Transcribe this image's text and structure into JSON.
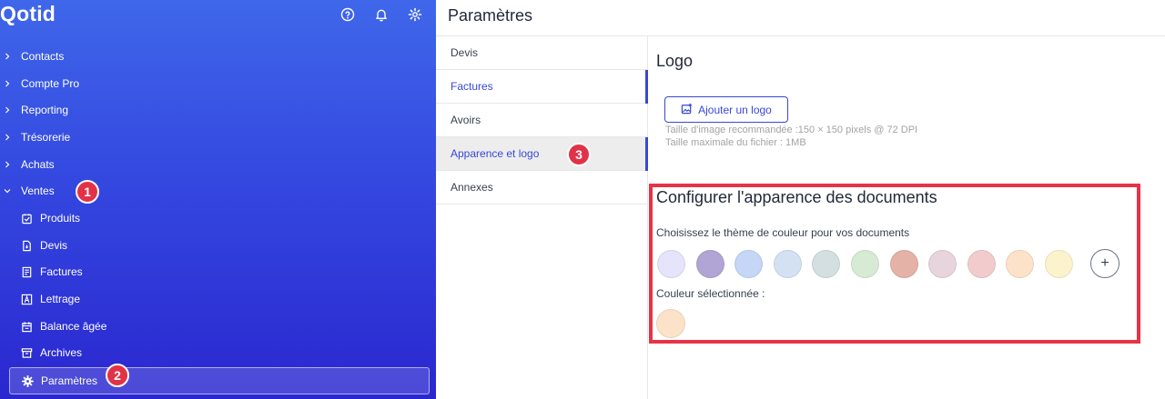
{
  "sidebar": {
    "brand": "Qotid",
    "top_icons": [
      "help-icon",
      "bell-icon",
      "gear-icon"
    ],
    "nav": [
      {
        "label": "Contacts",
        "expanded": false
      },
      {
        "label": "Compte Pro",
        "expanded": false
      },
      {
        "label": "Reporting",
        "expanded": false
      },
      {
        "label": "Trésorerie",
        "expanded": false
      },
      {
        "label": "Achats",
        "expanded": false
      },
      {
        "label": "Ventes",
        "expanded": true
      }
    ],
    "sub_items": [
      {
        "label": "Produits",
        "icon": "product-icon"
      },
      {
        "label": "Devis",
        "icon": "document-icon"
      },
      {
        "label": "Factures",
        "icon": "invoice-icon"
      },
      {
        "label": "Lettrage",
        "icon": "lettering-icon"
      },
      {
        "label": "Balance âgée",
        "icon": "calendar-icon"
      },
      {
        "label": "Archives",
        "icon": "archive-icon"
      },
      {
        "label": "Paramètres",
        "icon": "gear-icon",
        "active": true
      }
    ]
  },
  "annotations": [
    "1",
    "2",
    "3"
  ],
  "header": {
    "title": "Paramètres"
  },
  "settings_menu": [
    {
      "label": "Devis"
    },
    {
      "label": "Factures"
    },
    {
      "label": "Avoirs"
    },
    {
      "label": "Apparence et logo",
      "selected": true
    },
    {
      "label": "Annexes"
    }
  ],
  "logo_section": {
    "title": "Logo",
    "button_label": "Ajouter un logo",
    "hint_size": "Taille d'image recommandée :150 × 150 pixels @ 72 DPI",
    "hint_max": "Taille maximale du fichier : 1MB"
  },
  "appearance": {
    "title": "Configurer l'apparence des documents",
    "theme_label": "Choisissez le thème de couleur pour vos documents",
    "swatches": [
      "#e4e4fa",
      "#b1a5d6",
      "#c6d6f6",
      "#d3e1f2",
      "#d3dfe0",
      "#d7ead3",
      "#e4b2a6",
      "#e8d4dc",
      "#f2cccc",
      "#fce2c8",
      "#fcf3cc"
    ],
    "add_label": "+",
    "selected_label": "Couleur sélectionnée :",
    "selected_color": "#fce2c8"
  },
  "colors": {
    "accent": "#3947d6",
    "annotation": "#e23248",
    "highlight_box": "#e63347"
  }
}
